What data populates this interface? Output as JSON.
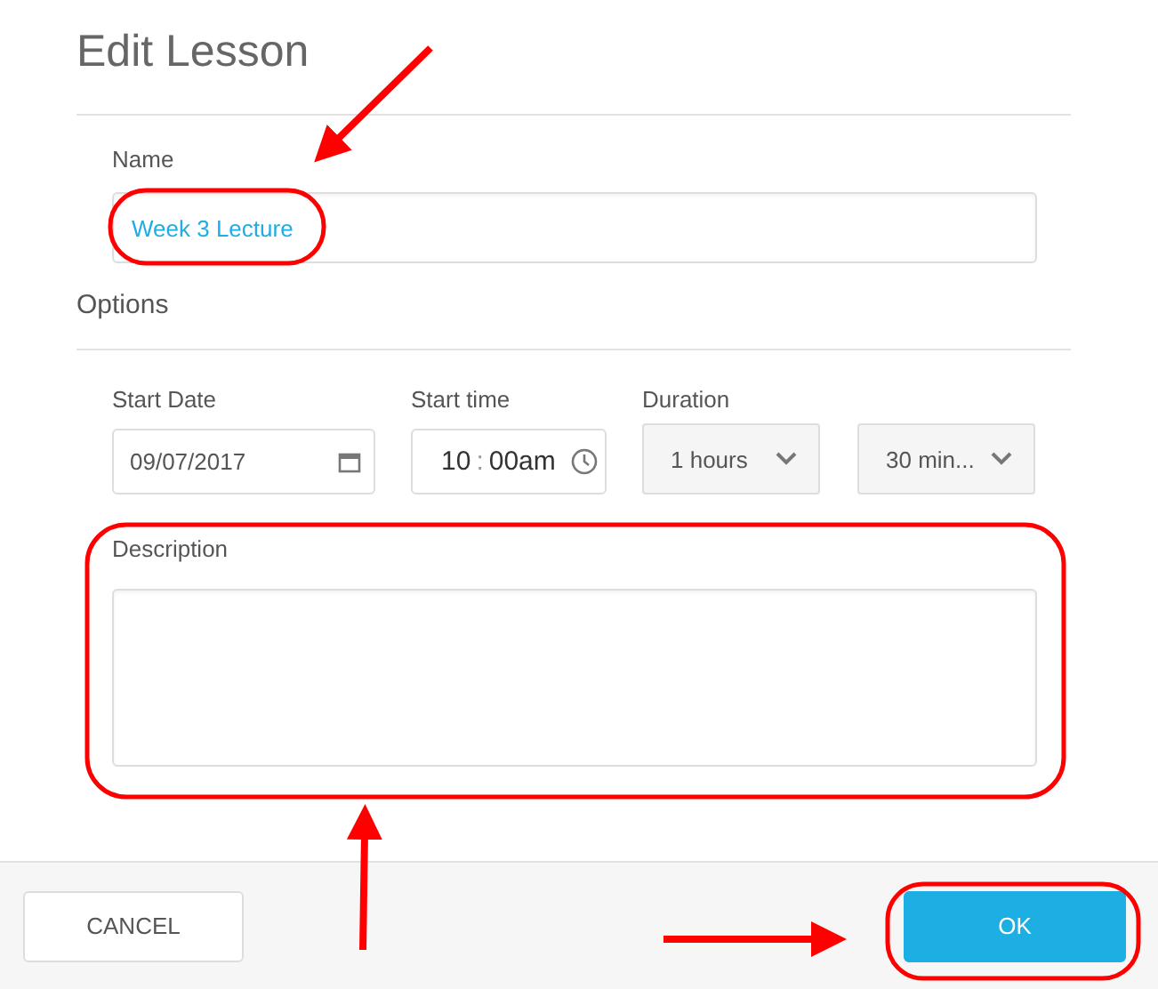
{
  "dialog": {
    "title": "Edit Lesson"
  },
  "name_field": {
    "label": "Name",
    "value": "Week 3 Lecture"
  },
  "options": {
    "heading": "Options",
    "start_date": {
      "label": "Start Date",
      "value": "09/07/2017"
    },
    "start_time": {
      "label": "Start time",
      "hour": "10",
      "separator": ":",
      "minute": "00",
      "period": "am"
    },
    "duration": {
      "label": "Duration",
      "hours": "1 hours",
      "minutes": "30 min..."
    }
  },
  "description": {
    "label": "Description"
  },
  "buttons": [
    {
      "kind": "secondary",
      "label": "CANCEL"
    },
    {
      "kind": "primary",
      "label": "OK"
    }
  ]
}
